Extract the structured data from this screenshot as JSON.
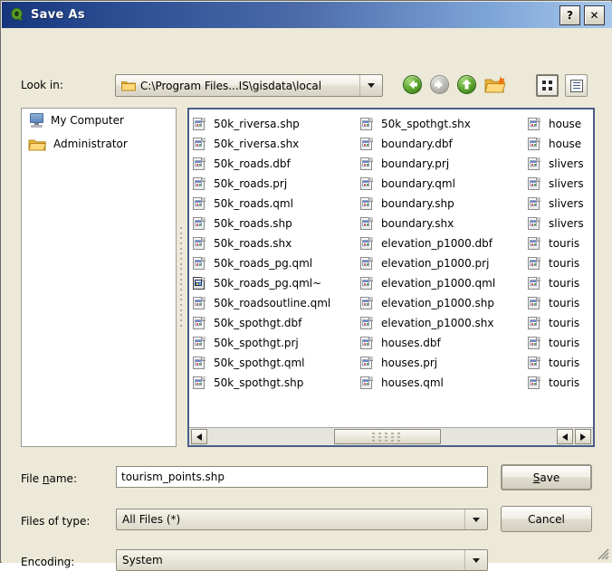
{
  "window": {
    "title": "Save As",
    "app_icon": "qgis-q-icon",
    "help_button": "?",
    "close_button": "✕",
    "titlebar_color_left": "#16357c",
    "titlebar_color_right": "#a8c8ea",
    "dialog_bg": "#ece9d8"
  },
  "lookin": {
    "label": "Look in:",
    "path": "C:\\Program Files...IS\\gisdata\\local",
    "folder_icon": "folder-icon",
    "dropdown_icon": "chevron-down-icon"
  },
  "toolbar": {
    "back": {
      "name": "back-icon",
      "enabled": true
    },
    "forward": {
      "name": "forward-icon",
      "enabled": false
    },
    "up": {
      "name": "parent-directory-icon",
      "enabled": true
    },
    "new_folder": {
      "name": "new-folder-icon",
      "enabled": true
    },
    "list_view": {
      "name": "list-view-icon",
      "active": true
    },
    "detail_view": {
      "name": "detail-view-icon",
      "active": false
    }
  },
  "sidebar": {
    "items": [
      {
        "label": "My Computer",
        "icon": "computer-icon"
      },
      {
        "label": "Administrator",
        "icon": "folder-icon"
      }
    ]
  },
  "filelist": {
    "columns": [
      [
        {
          "name": "50k_riversa.shp",
          "icon": "file-icon"
        },
        {
          "name": "50k_riversa.shx",
          "icon": "file-icon"
        },
        {
          "name": "50k_roads.dbf",
          "icon": "file-icon"
        },
        {
          "name": "50k_roads.prj",
          "icon": "file-icon"
        },
        {
          "name": "50k_roads.qml",
          "icon": "file-icon"
        },
        {
          "name": "50k_roads.shp",
          "icon": "file-icon"
        },
        {
          "name": "50k_roads.shx",
          "icon": "file-icon"
        },
        {
          "name": "50k_roads_pg.qml",
          "icon": "file-icon"
        },
        {
          "name": "50k_roads_pg.qml~",
          "icon": "file-icon-alt"
        },
        {
          "name": "50k_roadsoutline.qml",
          "icon": "file-icon"
        },
        {
          "name": "50k_spothgt.dbf",
          "icon": "file-icon"
        },
        {
          "name": "50k_spothgt.prj",
          "icon": "file-icon"
        },
        {
          "name": "50k_spothgt.qml",
          "icon": "file-icon"
        },
        {
          "name": "50k_spothgt.shp",
          "icon": "file-icon"
        }
      ],
      [
        {
          "name": "50k_spothgt.shx",
          "icon": "file-icon"
        },
        {
          "name": "boundary.dbf",
          "icon": "file-icon"
        },
        {
          "name": "boundary.prj",
          "icon": "file-icon"
        },
        {
          "name": "boundary.qml",
          "icon": "file-icon"
        },
        {
          "name": "boundary.shp",
          "icon": "file-icon"
        },
        {
          "name": "boundary.shx",
          "icon": "file-icon"
        },
        {
          "name": "elevation_p1000.dbf",
          "icon": "file-icon"
        },
        {
          "name": "elevation_p1000.prj",
          "icon": "file-icon"
        },
        {
          "name": "elevation_p1000.qml",
          "icon": "file-icon"
        },
        {
          "name": "elevation_p1000.shp",
          "icon": "file-icon"
        },
        {
          "name": "elevation_p1000.shx",
          "icon": "file-icon"
        },
        {
          "name": "houses.dbf",
          "icon": "file-icon"
        },
        {
          "name": "houses.prj",
          "icon": "file-icon"
        },
        {
          "name": "houses.qml",
          "icon": "file-icon"
        }
      ],
      [
        {
          "name": "house",
          "icon": "file-icon"
        },
        {
          "name": "house",
          "icon": "file-icon"
        },
        {
          "name": "slivers",
          "icon": "file-icon"
        },
        {
          "name": "slivers",
          "icon": "file-icon"
        },
        {
          "name": "slivers",
          "icon": "file-icon"
        },
        {
          "name": "slivers",
          "icon": "file-icon"
        },
        {
          "name": "touris",
          "icon": "file-icon"
        },
        {
          "name": "touris",
          "icon": "file-icon"
        },
        {
          "name": "touris",
          "icon": "file-icon"
        },
        {
          "name": "touris",
          "icon": "file-icon"
        },
        {
          "name": "touris",
          "icon": "file-icon"
        },
        {
          "name": "touris",
          "icon": "file-icon"
        },
        {
          "name": "touris",
          "icon": "file-icon"
        },
        {
          "name": "touris",
          "icon": "file-icon"
        }
      ]
    ],
    "scrollbar": {
      "left_arrow": "scroll-left-icon",
      "right_arrow": "scroll-right-icon"
    }
  },
  "form": {
    "filename_label_pre": "File ",
    "filename_label_key": "n",
    "filename_label_post": "ame:",
    "filename_value": "tourism_points.shp",
    "filetype_label": "Files of type:",
    "filetype_value": "All Files (*)",
    "encoding_label": "Encoding:",
    "encoding_value": "System"
  },
  "buttons": {
    "save_key": "S",
    "save_rest": "ave",
    "cancel": "Cancel"
  }
}
